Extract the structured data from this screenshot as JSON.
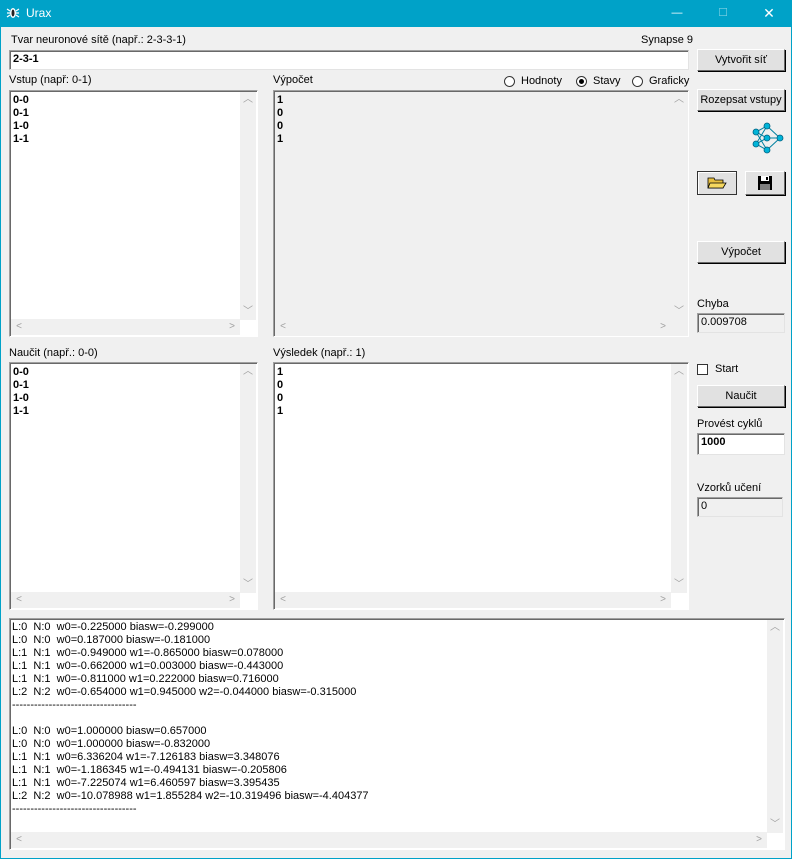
{
  "window": {
    "title": "Urax",
    "minimize": "—",
    "maximize": "☐",
    "close": "✕"
  },
  "topology": {
    "label": "Tvar neuronové sítě (např.: 2-3-3-1)",
    "value": "2-3-1",
    "synapse_label": "Synapse 9"
  },
  "buttons": {
    "create": "Vytvořit síť",
    "expand_inputs": "Rozepsat vstupy",
    "compute": "Výpočet",
    "learn": "Naučit"
  },
  "input": {
    "label": "Vstup (např: 0-1)",
    "lines": [
      "0-0",
      "0-1",
      "1-0",
      "1-1"
    ]
  },
  "output": {
    "label": "Výpočet",
    "mode_values": "Hodnoty",
    "mode_states": "Stavy",
    "mode_graphic": "Graficky",
    "lines": [
      "1",
      "0",
      "0",
      "1"
    ]
  },
  "learn": {
    "label": "Naučit (např.: 0-0)",
    "lines": [
      "0-0",
      "0-1",
      "1-0",
      "1-1"
    ]
  },
  "result": {
    "label": "Výsledek (např.: 1)",
    "lines": [
      "1",
      "0",
      "0",
      "1"
    ]
  },
  "error": {
    "label": "Chyba",
    "value": "0.009708"
  },
  "start": {
    "label": "Start"
  },
  "cycles": {
    "label": "Provést cyklů",
    "value": "1000"
  },
  "samples": {
    "label": "Vzorků učení",
    "value": "0"
  },
  "log": {
    "lines": [
      "L:0  N:0  w0=-0.225000 biasw=-0.299000",
      "L:0  N:0  w0=0.187000 biasw=-0.181000",
      "L:1  N:1  w0=-0.949000 w1=-0.865000 biasw=0.078000",
      "L:1  N:1  w0=-0.662000 w1=0.003000 biasw=-0.443000",
      "L:1  N:1  w0=-0.811000 w1=0.222000 biasw=0.716000",
      "L:2  N:2  w0=-0.654000 w1=0.945000 w2=-0.044000 biasw=-0.315000",
      "----------------------------------",
      "",
      "L:0  N:0  w0=1.000000 biasw=0.657000",
      "L:0  N:0  w0=1.000000 biasw=-0.832000",
      "L:1  N:1  w0=6.336204 w1=-7.126183 biasw=3.348076",
      "L:1  N:1  w0=-1.186345 w1=-0.494131 biasw=-0.205806",
      "L:1  N:1  w0=-7.225074 w1=6.460597 biasw=3.395435",
      "L:2  N:2  w0=-10.078988 w1=1.855284 w2=-10.319496 biasw=-4.404377",
      "----------------------------------"
    ]
  },
  "colors": {
    "titlebar": "#00a2c8",
    "network_icon": "#00b4d8"
  }
}
